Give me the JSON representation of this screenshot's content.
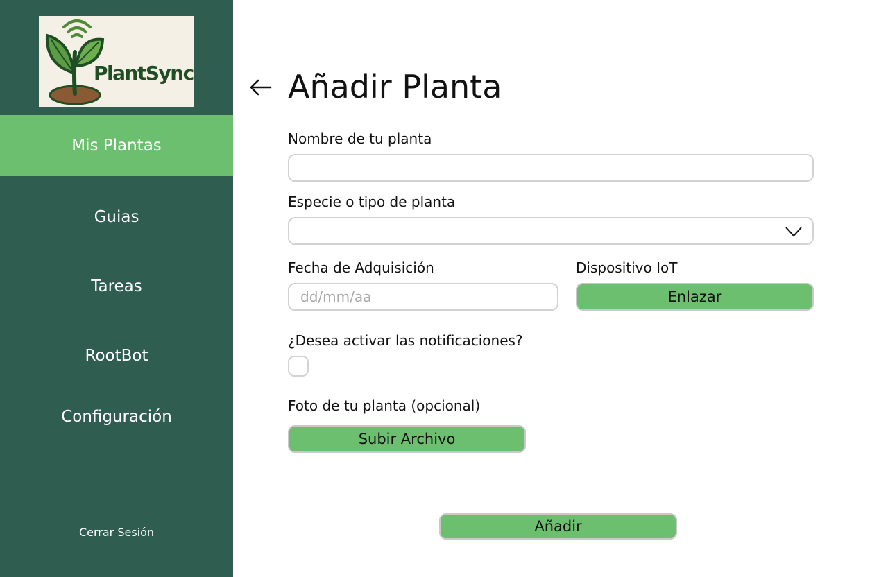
{
  "app": {
    "brand": "PlantSync"
  },
  "sidebar": {
    "items": [
      {
        "label": "Mis Plantas",
        "active": true
      },
      {
        "label": "Guias",
        "active": false
      },
      {
        "label": "Tareas",
        "active": false
      },
      {
        "label": "RootBot",
        "active": false
      },
      {
        "label": "Configuración",
        "active": false
      }
    ],
    "logout_label": "Cerrar Sesión"
  },
  "main": {
    "title": "Añadir Planta",
    "back_icon": "arrow-left-icon",
    "fields": {
      "name_label": "Nombre de tu planta",
      "name_value": "",
      "species_label": "Especie o tipo de planta",
      "species_value": "",
      "date_label": "Fecha de Adquisición",
      "date_value": "",
      "date_placeholder": "dd/mm/aa",
      "iot_label": "Dispositivo IoT",
      "iot_button": "Enlazar",
      "notifications_label": "¿Desea activar las notificaciones?",
      "notifications_checked": false,
      "photo_label": "Foto de tu planta (opcional)",
      "photo_button": "Subir Archivo"
    },
    "submit_label": "Añadir"
  },
  "colors": {
    "sidebar_bg": "#2f5e50",
    "accent_green": "#6dbf70",
    "logo_bg": "#f5f0e6",
    "border": "#d2d2d2"
  }
}
